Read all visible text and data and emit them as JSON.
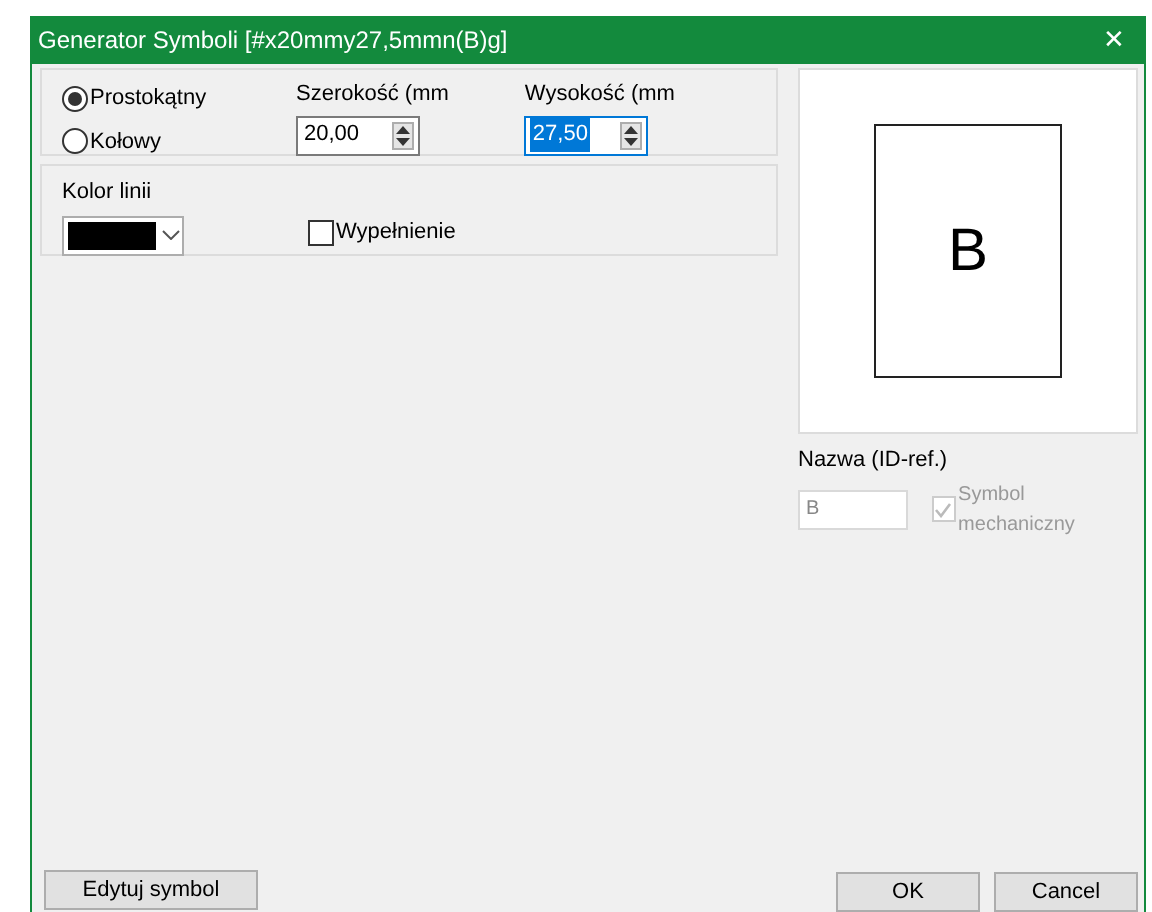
{
  "window": {
    "title": "Generator Symboli [#x20mmy27,5mmn(B)g]",
    "close": "✕"
  },
  "shape_options": [
    {
      "label": "Prostokątny",
      "selected": true
    },
    {
      "label": "Kołowy",
      "selected": false
    }
  ],
  "width_field": {
    "label": "Szerokość (mm",
    "value": "20,00",
    "focused": false
  },
  "height_field": {
    "label": "Wysokość (mm",
    "value": "27,50",
    "focused": true
  },
  "line_color": {
    "label": "Kolor linii",
    "color": "#000000"
  },
  "fill": {
    "label": "Wypełnienie",
    "checked": false
  },
  "preview": {
    "symbol": "B"
  },
  "name_field": {
    "label": "Nazwa (ID-ref.)",
    "value": "B"
  },
  "mechanical": {
    "label": "Symbol mechaniczny",
    "checked": true,
    "disabled": true
  },
  "buttons": {
    "edit": "Edytuj symbol",
    "ok": "OK",
    "cancel": "Cancel"
  }
}
